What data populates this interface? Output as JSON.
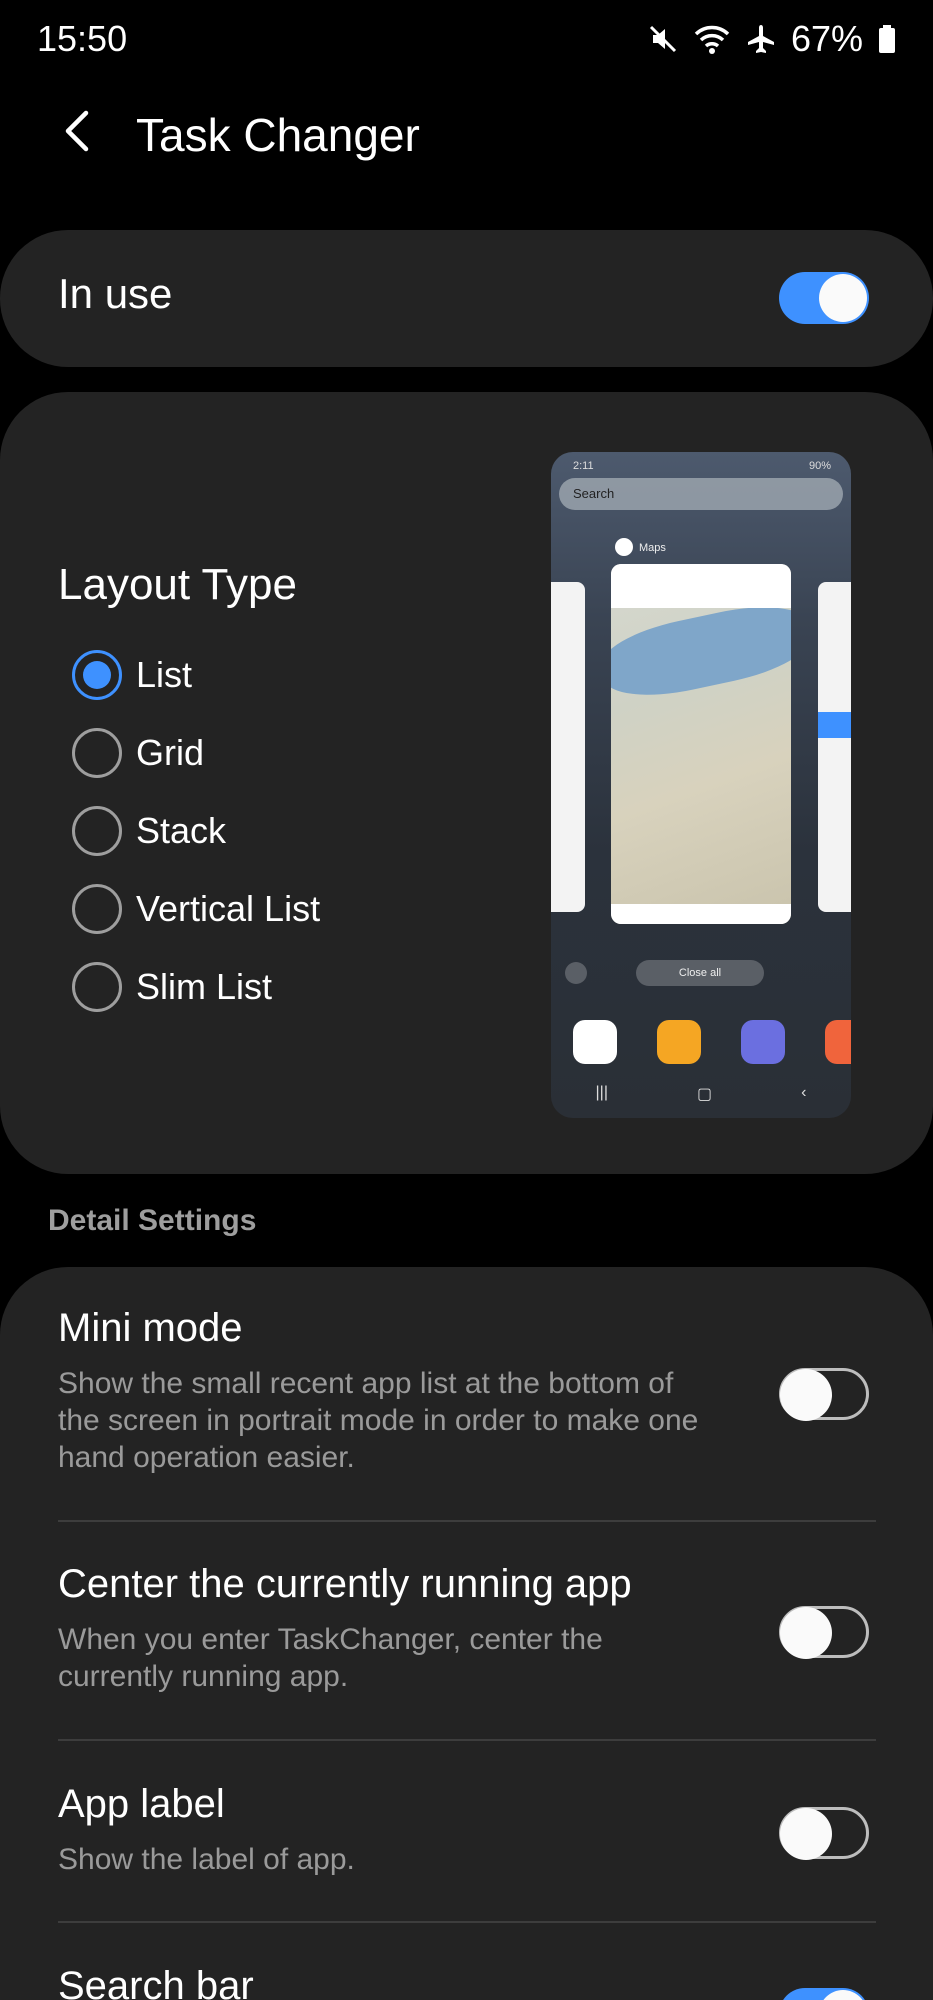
{
  "status_bar": {
    "time": "15:50",
    "battery": "67%",
    "icons": [
      "mute-icon",
      "wifi-icon",
      "airplane-icon",
      "battery-icon"
    ]
  },
  "app_bar": {
    "title": "Task Changer",
    "back_icon": "back-arrow-icon"
  },
  "in_use": {
    "label": "In use",
    "enabled": true
  },
  "layout_type": {
    "title": "Layout Type",
    "options": [
      {
        "label": "List",
        "selected": true
      },
      {
        "label": "Grid",
        "selected": false
      },
      {
        "label": "Stack",
        "selected": false
      },
      {
        "label": "Vertical List",
        "selected": false
      },
      {
        "label": "Slim List",
        "selected": false
      }
    ],
    "preview": {
      "time": "2:11",
      "battery": "90%",
      "search_placeholder": "Search",
      "app_label": "Maps",
      "close_all": "Close all"
    }
  },
  "detail_settings": {
    "header": "Detail Settings",
    "items": [
      {
        "title": "Mini mode",
        "description": "Show the small recent app list at the bottom of the screen in portrait mode in order to make one hand operation easier.",
        "enabled": false
      },
      {
        "title": "Center the currently running app",
        "description": "When you enter TaskChanger, center the currently running app.",
        "enabled": false
      },
      {
        "title": "App label",
        "description": "Show the label of app.",
        "enabled": false
      },
      {
        "title": "Search bar",
        "description": "",
        "enabled": true
      }
    ]
  },
  "colors": {
    "accent": "#3e91ff",
    "card": "#232323",
    "background": "#000000",
    "secondary_text": "#9a9a9a"
  }
}
